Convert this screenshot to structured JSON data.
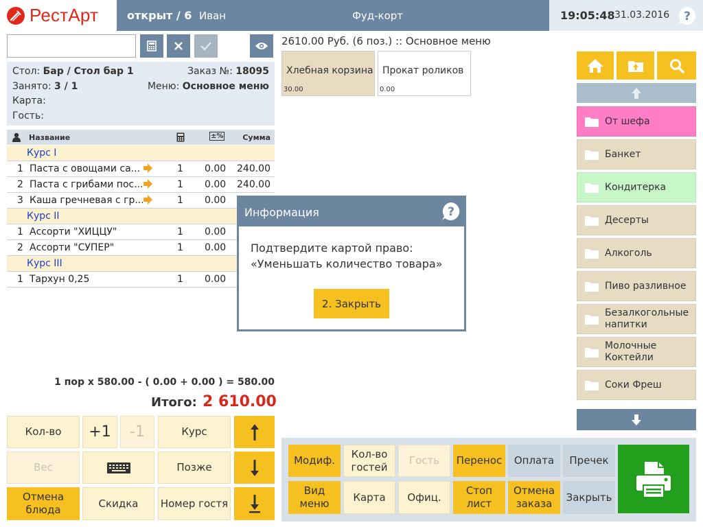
{
  "header": {
    "logo_text": "РестАрт",
    "order_status": "открыт / 6",
    "waiter": "Иван",
    "venue": "Фуд-корт",
    "time": "19:05:48",
    "date": "31.03.2016"
  },
  "search": {
    "value": "",
    "placeholder": ""
  },
  "order_info": {
    "table_label": "Стол:",
    "table_value": "Бар / Стол бар 1",
    "order_label": "Заказ №:",
    "order_value": "18095",
    "busy_label": "Занято:",
    "busy_value": "3 / 1",
    "menu_label": "Меню:",
    "menu_value": "Основное меню",
    "card_label": "Карта:",
    "guest_label": "Гость:"
  },
  "table": {
    "headers": {
      "name": "Название",
      "discount": "±%",
      "sum": "Сумма"
    },
    "rows": [
      {
        "type": "course",
        "name": "Курс I"
      },
      {
        "type": "item",
        "num": "1",
        "name": "Паста с овощами са...",
        "arrow": true,
        "qty": "1",
        "discount": "0.00",
        "sum": "240.00"
      },
      {
        "type": "item",
        "num": "2",
        "name": "Паста с грибами пос...",
        "arrow": true,
        "qty": "1",
        "discount": "0.00",
        "sum": "240.00"
      },
      {
        "type": "item",
        "num": "3",
        "name": "Каша гречневая с гр...",
        "arrow": true,
        "qty": "1",
        "discount": "0.00",
        "sum": ""
      },
      {
        "type": "course",
        "name": "Курс II"
      },
      {
        "type": "item",
        "num": "1",
        "name": "Ассорти \"ХИЦЦУ\"",
        "arrow": false,
        "qty": "1",
        "discount": "0.00",
        "sum": ""
      },
      {
        "type": "item",
        "num": "2",
        "name": "Ассорти \"СУПЕР\"",
        "arrow": false,
        "qty": "1",
        "discount": "0.00",
        "sum": ""
      },
      {
        "type": "course",
        "name": "Курс III"
      },
      {
        "type": "item",
        "num": "1",
        "name": "Тархун 0,25",
        "arrow": false,
        "qty": "1",
        "discount": "0.00",
        "sum": ""
      }
    ]
  },
  "summary": {
    "calc_line": "1 пор x 580.00 - ( 0.00 + 0.00 ) = 580.00",
    "total_label": "Итого:",
    "total_value": "2 610.00"
  },
  "keypad": {
    "qty": "Кол-во",
    "plus": "+1",
    "minus": "-1",
    "course": "Курс",
    "weight": "Вес",
    "later": "Позже",
    "cancel_dish": "Отмена блюда",
    "discount": "Скидка",
    "guest_number": "Номер гостя"
  },
  "menu": {
    "header": "2610.00 Руб. (6 поз.)  ::  Основное меню",
    "products": [
      {
        "name": "Хлебная корзина",
        "price": "30.00",
        "color": "#e7dcc2"
      },
      {
        "name": "Прокат роликов",
        "price": "0.00",
        "color": "#ffffff"
      }
    ]
  },
  "categories": [
    {
      "name": "От шефа",
      "style": "pink"
    },
    {
      "name": "Банкет",
      "style": "beige"
    },
    {
      "name": "Кондитерка",
      "style": "green"
    },
    {
      "name": "Десерты",
      "style": "beige"
    },
    {
      "name": "Алкоголь",
      "style": "beige"
    },
    {
      "name": "Пиво разливное",
      "style": "beige"
    },
    {
      "name": "Безалкогольные напитки",
      "style": "beige"
    },
    {
      "name": "Молочные Коктейли",
      "style": "beige"
    },
    {
      "name": "Соки Фреш",
      "style": "beige"
    }
  ],
  "actions": {
    "modif": "Модиф.",
    "guests_count": "Кол-во гостей",
    "guest": "Гость",
    "transfer": "Перенос",
    "payment": "Оплата",
    "precheck": "Пречек",
    "view_menu": "Вид меню",
    "card": "Карта",
    "waiter": "Офиц.",
    "stop_list": "Стоп лист",
    "cancel_order": "Отмена заказа",
    "close": "Закрыть"
  },
  "modal": {
    "title": "Информация",
    "line1": "Подтвердите картой право:",
    "line2": "«Уменьшать количество товара»",
    "button": "2. Закрыть"
  },
  "colors": {
    "header": "#6a86a0",
    "accent_yellow": "#f6c021",
    "cream": "#fdf3d0",
    "total_red": "#d42a1c",
    "print_green": "#219f1d",
    "chef_pink": "#ff7dc5",
    "pastry_green": "#c7f7c9"
  }
}
